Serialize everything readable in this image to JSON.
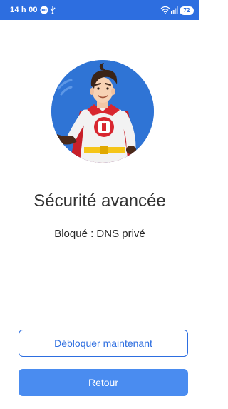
{
  "status_bar": {
    "time": "14 h 00",
    "battery": "72",
    "icons": [
      "message-notification-icon",
      "usb-icon",
      "wifi-icon",
      "signal-icon",
      "battery-icon"
    ],
    "background_color": "#2d6ee0"
  },
  "hero": {
    "illustration": "superhero-mascot",
    "background_color": "#2f74d5"
  },
  "screen": {
    "title": "Sécurité avancée",
    "subtitle": "Bloqué : DNS privé"
  },
  "actions": {
    "unblock_label": "Débloquer maintenant",
    "back_label": "Retour",
    "accent_color": "#2d6ee0",
    "primary_color": "#4a8cf0"
  }
}
